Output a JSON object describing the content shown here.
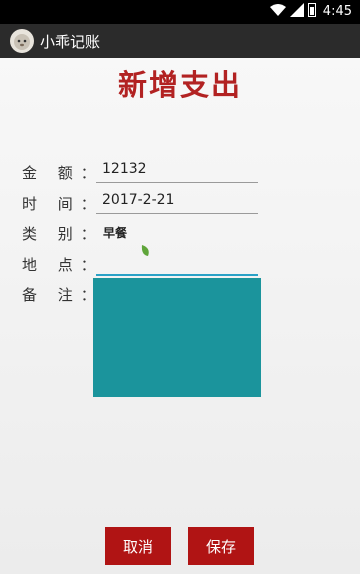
{
  "status_bar": {
    "time": "4:45"
  },
  "app": {
    "title": "小乖记账"
  },
  "page": {
    "title": "新增支出"
  },
  "form": {
    "amount_label": "金 额：",
    "amount_value": "12132",
    "time_label": "时 间：",
    "time_value": "2017-2-21",
    "category_label": "类 别：",
    "category_value": "早餐",
    "location_label": "地 点：",
    "location_value": "",
    "note_label": "备 注："
  },
  "buttons": {
    "cancel": "取消",
    "save": "保存"
  },
  "colors": {
    "title": "#b22222",
    "button": "#b01414",
    "notes_background": "#1b949c",
    "field_active": "#2aa1c6"
  }
}
